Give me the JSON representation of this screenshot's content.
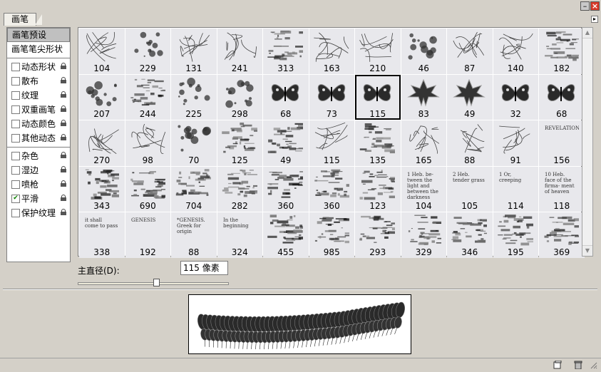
{
  "panel": {
    "tab_label": "画笔",
    "menu_icon": "flyout-menu-arrow-icon"
  },
  "sidebar": {
    "items": [
      {
        "label": "画笔预设",
        "type": "header",
        "selected": true
      },
      {
        "label": "画笔笔尖形状",
        "type": "plain"
      },
      {
        "label": "动态形状",
        "type": "option",
        "checked": false,
        "locked": true
      },
      {
        "label": "散布",
        "type": "option",
        "checked": false,
        "locked": true
      },
      {
        "label": "纹理",
        "type": "option",
        "checked": false,
        "locked": true
      },
      {
        "label": "双重画笔",
        "type": "option",
        "checked": false,
        "locked": true
      },
      {
        "label": "动态颜色",
        "type": "option",
        "checked": false,
        "locked": true
      },
      {
        "label": "其他动态",
        "type": "option",
        "checked": false,
        "locked": true
      },
      {
        "label": "杂色",
        "type": "option",
        "checked": false,
        "locked": true
      },
      {
        "label": "湿边",
        "type": "option",
        "checked": false,
        "locked": true
      },
      {
        "label": "喷枪",
        "type": "option",
        "checked": false,
        "locked": true
      },
      {
        "label": "平滑",
        "type": "option",
        "checked": true,
        "locked": true
      },
      {
        "label": "保护纹理",
        "type": "option",
        "checked": false,
        "locked": true
      }
    ]
  },
  "brushes": [
    {
      "size": "104",
      "kind": "scribble"
    },
    {
      "size": "229",
      "kind": "splotch"
    },
    {
      "size": "131",
      "kind": "scribble"
    },
    {
      "size": "241",
      "kind": "scribble"
    },
    {
      "size": "313",
      "kind": "texture"
    },
    {
      "size": "163",
      "kind": "scribble"
    },
    {
      "size": "210",
      "kind": "scribble"
    },
    {
      "size": "46",
      "kind": "splotch"
    },
    {
      "size": "87",
      "kind": "scribble"
    },
    {
      "size": "140",
      "kind": "scribble"
    },
    {
      "size": "182",
      "kind": "texture"
    },
    {
      "size": "207",
      "kind": "splotch"
    },
    {
      "size": "244",
      "kind": "texture"
    },
    {
      "size": "225",
      "kind": "splotch"
    },
    {
      "size": "298",
      "kind": "splotch"
    },
    {
      "size": "68",
      "kind": "butterfly"
    },
    {
      "size": "73",
      "kind": "butterfly"
    },
    {
      "size": "115",
      "kind": "butterfly",
      "selected": true
    },
    {
      "size": "83",
      "kind": "leaf"
    },
    {
      "size": "49",
      "kind": "leaf"
    },
    {
      "size": "32",
      "kind": "butterfly"
    },
    {
      "size": "68",
      "kind": "butterfly"
    },
    {
      "size": "270",
      "kind": "scribble"
    },
    {
      "size": "98",
      "kind": "scribble"
    },
    {
      "size": "70",
      "kind": "splotch"
    },
    {
      "size": "125",
      "kind": "texture"
    },
    {
      "size": "49",
      "kind": "texture"
    },
    {
      "size": "115",
      "kind": "scribble"
    },
    {
      "size": "135",
      "kind": "texture"
    },
    {
      "size": "165",
      "kind": "scribble"
    },
    {
      "size": "88",
      "kind": "scribble"
    },
    {
      "size": "91",
      "kind": "scribble"
    },
    {
      "size": "156",
      "kind": "text",
      "text": "REVELATION"
    },
    {
      "size": "343",
      "kind": "texture"
    },
    {
      "size": "690",
      "kind": "texture"
    },
    {
      "size": "704",
      "kind": "texture"
    },
    {
      "size": "282",
      "kind": "texture"
    },
    {
      "size": "360",
      "kind": "texture"
    },
    {
      "size": "360",
      "kind": "texture"
    },
    {
      "size": "123",
      "kind": "texture"
    },
    {
      "size": "104",
      "kind": "text",
      "text": "1 Heb. be- tween the light and between the darkness"
    },
    {
      "size": "105",
      "kind": "text",
      "text": "2 Heb. tender grass"
    },
    {
      "size": "114",
      "kind": "text",
      "text": "1 Or, creeping"
    },
    {
      "size": "118",
      "kind": "text",
      "text": "10 Heb. face of the firma- ment of heaven"
    },
    {
      "size": "338",
      "kind": "text",
      "text": "it shall come to pass"
    },
    {
      "size": "192",
      "kind": "text",
      "text": "GENESIS"
    },
    {
      "size": "88",
      "kind": "text",
      "text": "*GENESIS. Greek for origin"
    },
    {
      "size": "324",
      "kind": "text",
      "text": "In the beginning"
    },
    {
      "size": "455",
      "kind": "texture"
    },
    {
      "size": "985",
      "kind": "texture"
    },
    {
      "size": "293",
      "kind": "texture"
    },
    {
      "size": "329",
      "kind": "texture"
    },
    {
      "size": "346",
      "kind": "texture"
    },
    {
      "size": "195",
      "kind": "texture"
    },
    {
      "size": "369",
      "kind": "texture"
    }
  ],
  "controls": {
    "diameter_label": "主直径(D):",
    "diameter_value": "115 像素",
    "diameter_fraction": 0.52
  },
  "status": {
    "icons": [
      "new-brush-icon",
      "trash-icon",
      "resize-grip-icon"
    ]
  }
}
